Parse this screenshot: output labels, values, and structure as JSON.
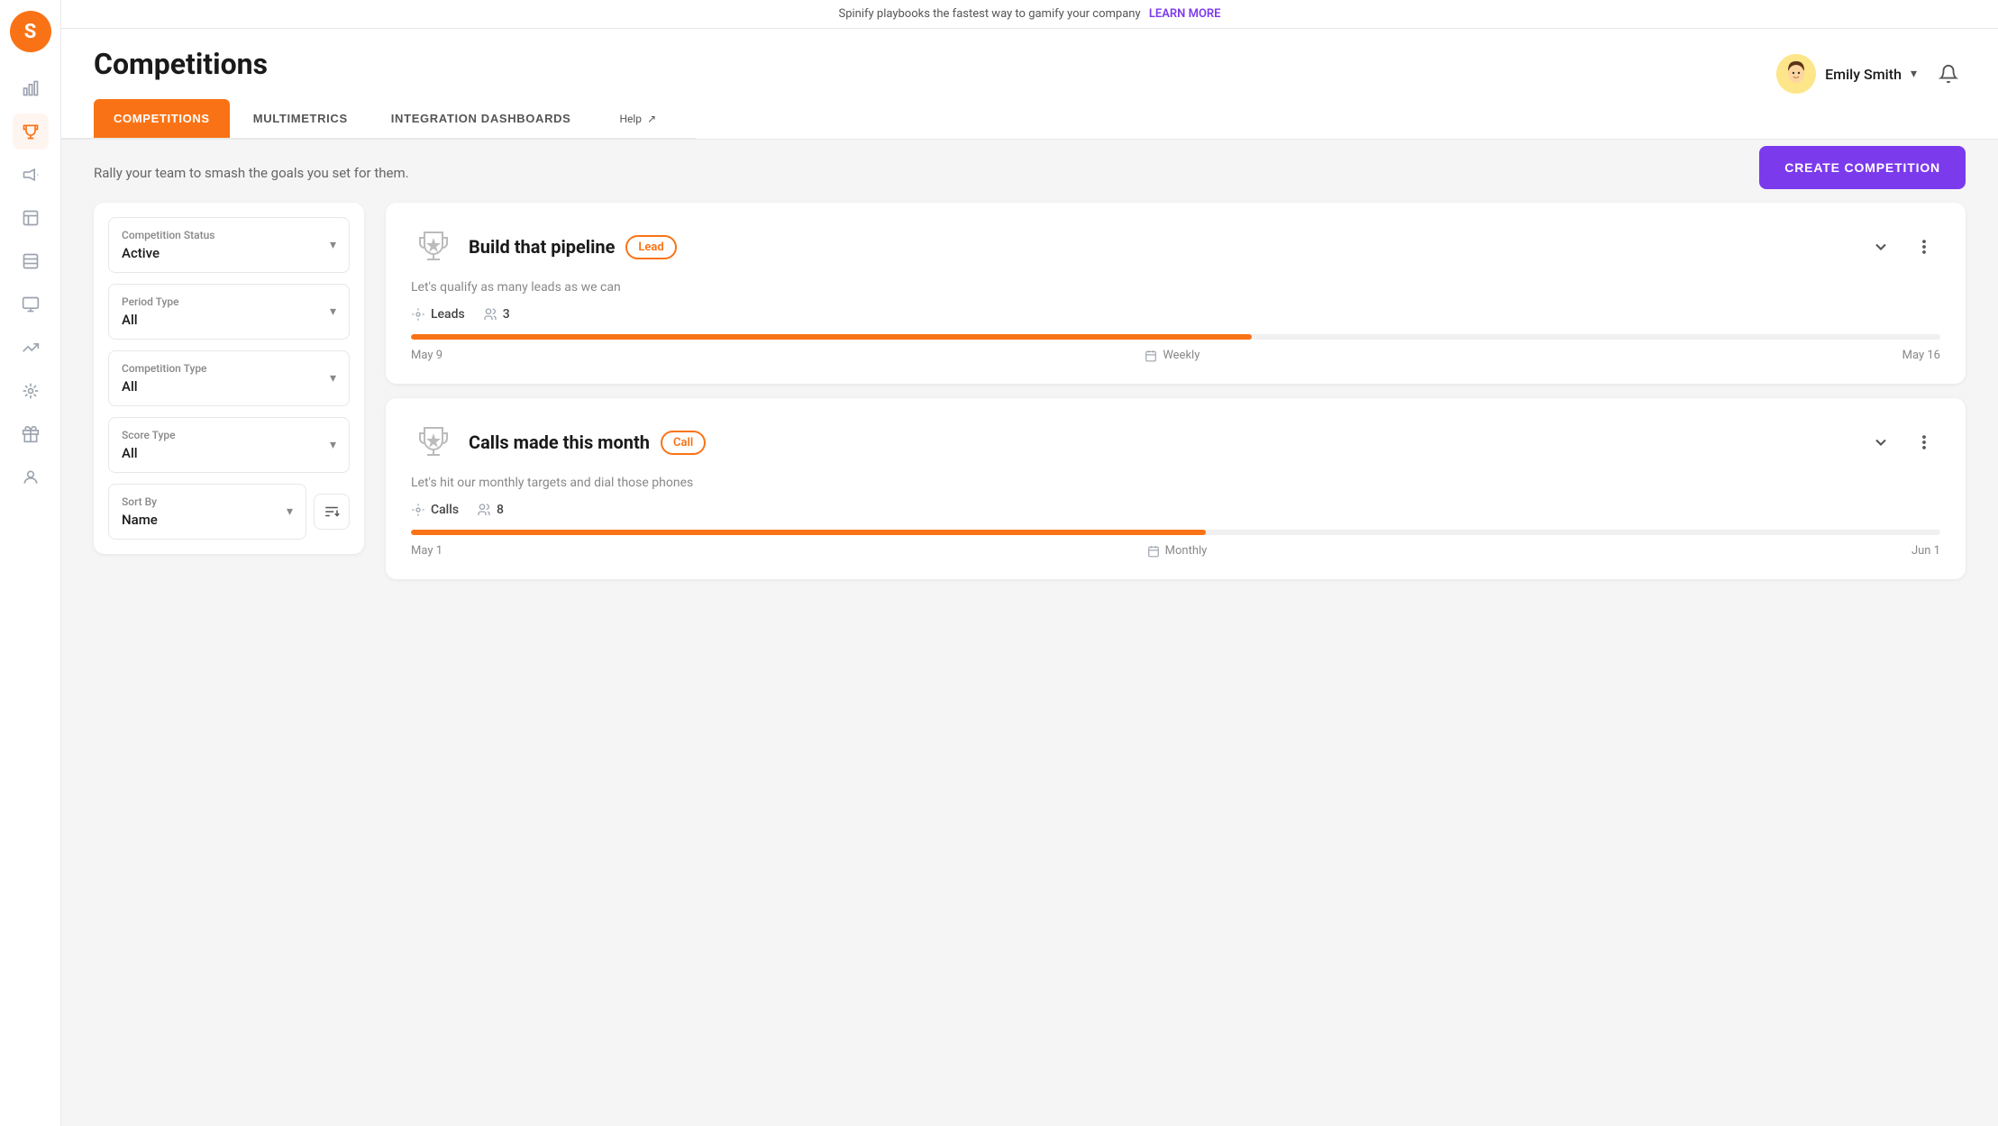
{
  "banner": {
    "text": "Spinify playbooks the fastest way to gamify your company",
    "link_text": "LEARN MORE"
  },
  "header": {
    "title": "Competitions",
    "user_name": "Emily Smith",
    "user_avatar_emoji": "👩"
  },
  "tabs": [
    {
      "id": "competitions",
      "label": "COMPETITIONS",
      "active": true
    },
    {
      "id": "multimetrics",
      "label": "MULTIMETRICS",
      "active": false
    },
    {
      "id": "integration-dashboards",
      "label": "INTEGRATION DASHBOARDS",
      "active": false
    }
  ],
  "help": {
    "label": "Help",
    "icon": "↗"
  },
  "create_button": {
    "label": "CREATE COMPETITION"
  },
  "tagline": "Rally your team to smash the goals you set for them.",
  "filters": {
    "competition_status": {
      "label": "Competition Status",
      "value": "Active"
    },
    "period_type": {
      "label": "Period Type",
      "value": "All"
    },
    "competition_type": {
      "label": "Competition Type",
      "value": "All"
    },
    "score_type": {
      "label": "Score Type",
      "value": "All"
    },
    "sort_by": {
      "label": "Sort By",
      "value": "Name"
    }
  },
  "competitions": [
    {
      "id": 1,
      "title": "Build that pipeline",
      "badge": "Lead",
      "description": "Let's qualify as many leads as we can",
      "metric": "Leads",
      "participants": "3",
      "progress": 55,
      "start_date": "May 9",
      "period": "Weekly",
      "end_date": "May 16"
    },
    {
      "id": 2,
      "title": "Calls made this month",
      "badge": "Call",
      "description": "Let's hit our monthly targets and dial those phones",
      "metric": "Calls",
      "participants": "8",
      "progress": 52,
      "start_date": "May 1",
      "period": "Monthly",
      "end_date": "Jun 1"
    }
  ],
  "sidebar_icons": [
    {
      "id": "logo",
      "emoji": "S"
    },
    {
      "id": "chart-bar",
      "emoji": "📊"
    },
    {
      "id": "trophy",
      "emoji": "🏆"
    },
    {
      "id": "megaphone",
      "emoji": "📢"
    },
    {
      "id": "report",
      "emoji": "📋"
    },
    {
      "id": "list",
      "emoji": "☰"
    },
    {
      "id": "monitor",
      "emoji": "🖥"
    },
    {
      "id": "trending",
      "emoji": "📈"
    },
    {
      "id": "sparkle",
      "emoji": "✨"
    },
    {
      "id": "gift",
      "emoji": "🎁"
    },
    {
      "id": "user",
      "emoji": "👤"
    }
  ]
}
